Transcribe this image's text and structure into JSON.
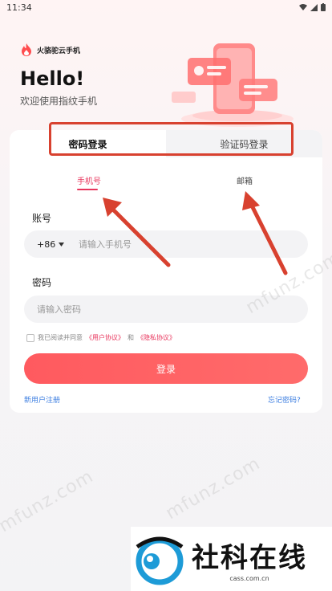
{
  "status": {
    "time": "11:34"
  },
  "brand": {
    "name": "火骆驼云手机"
  },
  "header": {
    "hello": "Hello!",
    "welcome": "欢迎使用指纹手机"
  },
  "tabs": [
    {
      "label": "密码登录",
      "active": true
    },
    {
      "label": "验证码登录",
      "active": false
    }
  ],
  "subtabs": [
    {
      "label": "手机号",
      "active": true
    },
    {
      "label": "邮箱",
      "active": false
    }
  ],
  "account": {
    "label": "账号",
    "country_code": "+86",
    "placeholder": "请输入手机号"
  },
  "password": {
    "label": "密码",
    "placeholder": "请输入密码"
  },
  "agreement": {
    "prefix": "我已阅读并同意",
    "user_agreement": "《用户协议》",
    "and": "和",
    "privacy": "《隐私协议》"
  },
  "login_button": "登录",
  "links": {
    "register": "新用户注册",
    "forgot": "忘记密码?"
  },
  "watermark": {
    "text": "mfunz.com"
  },
  "site": {
    "name": "社科在线",
    "url": "cass.com.cn"
  },
  "colors": {
    "accent": "#e8355c",
    "button": "#ff5a5f",
    "link": "#3b7de0",
    "annotation": "#d8412f"
  }
}
